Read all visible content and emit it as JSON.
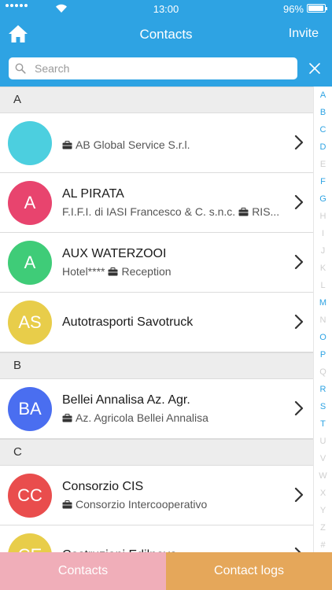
{
  "status_bar": {
    "time": "13:00",
    "battery": "96%"
  },
  "nav": {
    "title": "Contacts",
    "invite_label": "Invite"
  },
  "search": {
    "placeholder": "Search",
    "value": ""
  },
  "sections": [
    {
      "letter": "A",
      "contacts": [
        {
          "initials": "",
          "name": "",
          "subtitle_parts": [
            "AB Global Service S.r.l."
          ],
          "subtitle_icons": [
            true
          ],
          "color": "#4ccfdf"
        },
        {
          "initials": "A",
          "name": "AL PIRATA",
          "subtitle_parts": [
            "F.I.F.I. di IASI Francesco & C. s.n.c.",
            "RIS..."
          ],
          "subtitle_icons": [
            false,
            true
          ],
          "color": "#e8446e"
        },
        {
          "initials": "A",
          "name": "AUX WATERZOOI",
          "subtitle_parts": [
            "Hotel****",
            "Reception"
          ],
          "subtitle_icons": [
            false,
            true
          ],
          "color": "#3fcc78"
        },
        {
          "initials": "AS",
          "name": "Autotrasporti Savotruck",
          "subtitle_parts": [],
          "subtitle_icons": [],
          "color": "#e8cd4a"
        }
      ]
    },
    {
      "letter": "B",
      "contacts": [
        {
          "initials": "BA",
          "name": "Bellei Annalisa Az. Agr.",
          "subtitle_parts": [
            "Az. Agricola Bellei Annalisa"
          ],
          "subtitle_icons": [
            true
          ],
          "color": "#4a6ef0"
        }
      ]
    },
    {
      "letter": "C",
      "contacts": [
        {
          "initials": "CC",
          "name": "Consorzio CIS",
          "subtitle_parts": [
            "Consorzio Intercooperativo"
          ],
          "subtitle_icons": [
            true
          ],
          "color": "#e94d4d"
        },
        {
          "initials": "CE",
          "name": "Costruzioni Edilnova",
          "subtitle_parts": [],
          "subtitle_icons": [],
          "color": "#e8cd4a"
        }
      ]
    }
  ],
  "index": [
    {
      "letter": "A",
      "active": true
    },
    {
      "letter": "B",
      "active": true
    },
    {
      "letter": "C",
      "active": true
    },
    {
      "letter": "D",
      "active": true
    },
    {
      "letter": "E",
      "active": false
    },
    {
      "letter": "F",
      "active": true
    },
    {
      "letter": "G",
      "active": true
    },
    {
      "letter": "H",
      "active": false
    },
    {
      "letter": "I",
      "active": false
    },
    {
      "letter": "J",
      "active": false
    },
    {
      "letter": "K",
      "active": false
    },
    {
      "letter": "L",
      "active": false
    },
    {
      "letter": "M",
      "active": true
    },
    {
      "letter": "N",
      "active": false
    },
    {
      "letter": "O",
      "active": true
    },
    {
      "letter": "P",
      "active": true
    },
    {
      "letter": "Q",
      "active": false
    },
    {
      "letter": "R",
      "active": true
    },
    {
      "letter": "S",
      "active": true
    },
    {
      "letter": "T",
      "active": true
    },
    {
      "letter": "U",
      "active": false
    },
    {
      "letter": "V",
      "active": false
    },
    {
      "letter": "W",
      "active": false
    },
    {
      "letter": "X",
      "active": false
    },
    {
      "letter": "Y",
      "active": false
    },
    {
      "letter": "Z",
      "active": false
    },
    {
      "letter": "#",
      "active": false
    }
  ],
  "tabs": {
    "contacts_label": "Contacts",
    "logs_label": "Contact logs"
  },
  "colors": {
    "brand": "#2ea3e3",
    "tab_contacts": "#f0aeb9",
    "tab_logs": "#e5a75a"
  }
}
